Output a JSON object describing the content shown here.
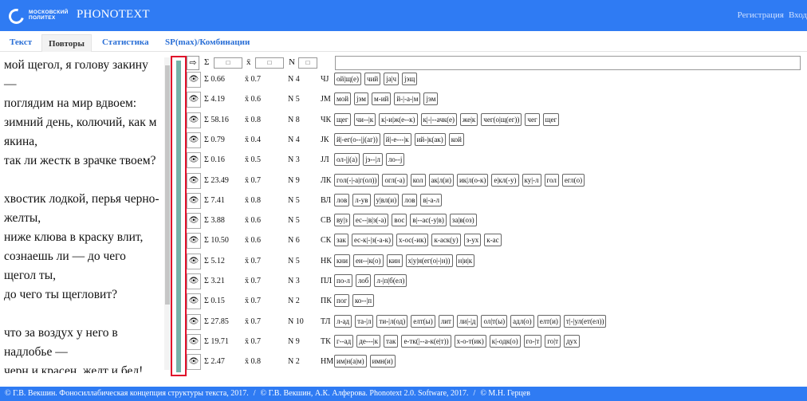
{
  "header": {
    "logo_line1": "МОСКОВСКИЙ",
    "logo_line2": "ПОЛИТЕХ",
    "title": "PHONOTEXT",
    "register": "Регистрация",
    "login": "Вход"
  },
  "tabs": [
    {
      "label": "Текст",
      "active": false
    },
    {
      "label": "Повторы",
      "active": true
    },
    {
      "label": "Статистика",
      "active": false
    },
    {
      "label": "SP(max)/Комбинации",
      "active": false
    }
  ],
  "poem": [
    "мой щегол, я голову закину",
    "—",
    "поглядим на мир вдвоем:",
    "зимний день, колючий, как м",
    "якина,",
    "так ли жестк в зрачке твоем?",
    "",
    "хвостик лодкой, перья черно-",
    "желты,",
    "ниже клюва в краску влит,",
    "сознаешь ли — до чего",
    "щегол ты,",
    "до чего ты щегловит?",
    "",
    "что за воздух у него в",
    "надлобье —",
    "черн и красен, желт и бел!"
  ],
  "controls": {
    "arrow": "⇨",
    "sum_symbol": "Σ",
    "mean_symbol": "x̄",
    "n_symbol": "N",
    "sum_value": "□",
    "mean_value": "□",
    "n_value": "□"
  },
  "rows": [
    {
      "sum": "Σ 0.66",
      "mean": "x̄ 0.7",
      "n": "N 4",
      "code": "ЧJ",
      "chips": [
        "ой|щ(е)",
        "чий",
        "ja|ч",
        "jэщ"
      ]
    },
    {
      "sum": "Σ 4.19",
      "mean": "x̄ 0.6",
      "n": "N 5",
      "code": "JМ",
      "chips": [
        "мой",
        "jэм",
        "м-ий",
        "й-|-а-|м",
        "jэм"
      ]
    },
    {
      "sum": "Σ 58.16",
      "mean": "x̄ 0.8",
      "n": "N 8",
      "code": "ЧК",
      "chips": [
        "щег",
        "чи--|к",
        "к|-и|ж(е--к)",
        "к|-|--ачк(е)",
        "же|к",
        "чег(о|щ(ег))",
        "чег",
        "щег"
      ]
    },
    {
      "sum": "Σ 0.79",
      "mean": "x̄ 0.4",
      "n": "N 4",
      "code": "JК",
      "chips": [
        "й|-ег(о--|j(аг))",
        "й|-е---|к",
        "ий-|к(ак)",
        "кой"
      ]
    },
    {
      "sum": "Σ 0.16",
      "mean": "x̄ 0.5",
      "n": "N 3",
      "code": "JЛ",
      "chips": [
        "ол-|j(а)",
        "jэ--|л",
        "ло--j"
      ]
    },
    {
      "sum": "Σ 23.49",
      "mean": "x̄ 0.7",
      "n": "N 9",
      "code": "ЛК",
      "chips": [
        "гол(-|-а|г(ол))",
        "огл(-а)",
        "кол",
        "ак|л(и)",
        "ик|л(о-к)",
        "е|кл(-у)",
        "ку|-л",
        "гол",
        "егл(о)"
      ]
    },
    {
      "sum": "Σ 7.41",
      "mean": "x̄ 0.8",
      "n": "N 5",
      "code": "ВЛ",
      "chips": [
        "лов",
        "л-ув",
        "у|вл(и)",
        "лов",
        "в|-а-л"
      ]
    },
    {
      "sum": "Σ 3.88",
      "mean": "x̄ 0.6",
      "n": "N 5",
      "code": "СВ",
      "chips": [
        "ву|з",
        "ес--|в|з(-а)",
        "вос",
        "в|--ас(-у|в)",
        "за|в(оз)"
      ]
    },
    {
      "sum": "Σ 10.50",
      "mean": "x̄ 0.6",
      "n": "N 6",
      "code": "СК",
      "chips": [
        "зак",
        "ес-к|-|з(-а-к)",
        "х-ос(-ик)",
        "к-аск(у)",
        "з-ух",
        "к-ас"
      ]
    },
    {
      "sum": "Σ 5.12",
      "mean": "x̄ 0.7",
      "n": "N 5",
      "code": "НК",
      "chips": [
        "кни",
        "ен--|к(о)",
        "кин",
        "х|у|н(ег(о|-|н))",
        "н|и|к"
      ]
    },
    {
      "sum": "Σ 3.21",
      "mean": "x̄ 0.7",
      "n": "N 3",
      "code": "ПЛ",
      "chips": [
        "по-л",
        "лоб",
        "л-|п|б(ел)"
      ]
    },
    {
      "sum": "Σ 0.15",
      "mean": "x̄ 0.7",
      "n": "N 2",
      "code": "ПК",
      "chips": [
        "пог",
        "ко--|п"
      ]
    },
    {
      "sum": "Σ 27.85",
      "mean": "x̄ 0.7",
      "n": "N 10",
      "code": "ТЛ",
      "chips": [
        "л-ад",
        "та-|л",
        "ти-|л(од)",
        "елт(ы)",
        "лит",
        "ли|-|д",
        "ол|т(ы)",
        "адл(о)",
        "елт(и)",
        "т|-|ул(ет(ел))"
      ]
    },
    {
      "sum": "Σ 19.71",
      "mean": "x̄ 0.7",
      "n": "N 9",
      "code": "ТК",
      "chips": [
        "г--ад",
        "де---|к",
        "так",
        "е-тк(|--а-к(е|т))",
        "х-о-т(ик)",
        "к|-одк(о)",
        "го-|т",
        "го|т",
        "дух"
      ]
    },
    {
      "sum": "Σ 2.47",
      "mean": "x̄ 0.8",
      "n": "N 2",
      "code": "НМ",
      "chips": [
        "им|н(а|м)",
        "имн(и)"
      ]
    }
  ],
  "footer": {
    "c1": "© Г.В. Векшин. Фоносиллабическая концепция структуры текста, 2017.",
    "c2": "© Г.В. Векшин, А.К. Алферова. Phonotext 2.0. Software, 2017.",
    "c3": "© М.Н. Герцев",
    "sep": "/"
  },
  "colors": {
    "brand": "#2f7bf3",
    "highlight": "#e0102a",
    "bar": "#76b3a9"
  }
}
